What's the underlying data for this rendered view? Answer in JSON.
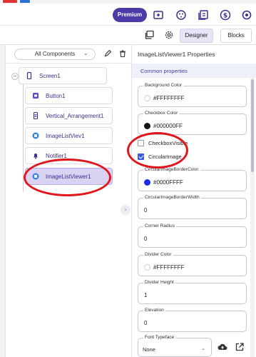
{
  "topbar": {
    "premium_label": "Premium",
    "icons": [
      "add-screen-icon",
      "palette-icon",
      "project-properties-icon",
      "dollar-icon",
      "settings-icon"
    ]
  },
  "toolbar": {
    "designer_label": "Designer",
    "blocks_label": "Blocks"
  },
  "components": {
    "filter_label": "All Components",
    "tree": [
      {
        "label": "Screen1",
        "icon": "phone-icon",
        "selected": false
      },
      {
        "label": "Button1",
        "icon": "button-icon",
        "selected": false
      },
      {
        "label": "Vertical_Arrangement1",
        "icon": "vertical-arrangement-icon",
        "selected": false
      },
      {
        "label": "ImageListViev1",
        "icon": "image-list-icon",
        "selected": false
      },
      {
        "label": "Notifier1",
        "icon": "bell-icon",
        "selected": false
      },
      {
        "label": "ImageListViewer1",
        "icon": "image-list-icon",
        "selected": true
      }
    ]
  },
  "properties": {
    "title": "ImageListViewer1 Properties",
    "section_label": "Common properties",
    "background_color": {
      "label": "Background Color",
      "value": "#FFFFFFFF",
      "swatch": "#ffffff"
    },
    "checkbox_color": {
      "label": "Checkbox Color",
      "value": "#000000FF",
      "swatch": "#111111"
    },
    "checkbox_visible": {
      "label": "CheckboxVisible",
      "checked": false
    },
    "circular_image": {
      "label": "CircularImage",
      "checked": true
    },
    "circular_border_color": {
      "label": "CircularImageBorderColor",
      "value": "#0000FFFF",
      "swatch": "#1a2ee6"
    },
    "circular_border_width": {
      "label": "CircularImageBorderWidth",
      "value": "0"
    },
    "corner_radius": {
      "label": "Corner Radius",
      "value": "0"
    },
    "divider_color": {
      "label": "Divider Color",
      "value": "#FFFFFFFF",
      "swatch": "#ffffff"
    },
    "divider_height": {
      "label": "Divider Height",
      "value": "1"
    },
    "elevation": {
      "label": "Elevation",
      "value": "0"
    },
    "font_typeface": {
      "label": "Font Typeface",
      "value": "None"
    }
  },
  "colors": {
    "accent": "#4b3aa8",
    "selected_bg": "#d9d2f3",
    "annotation": "#e0161b"
  }
}
